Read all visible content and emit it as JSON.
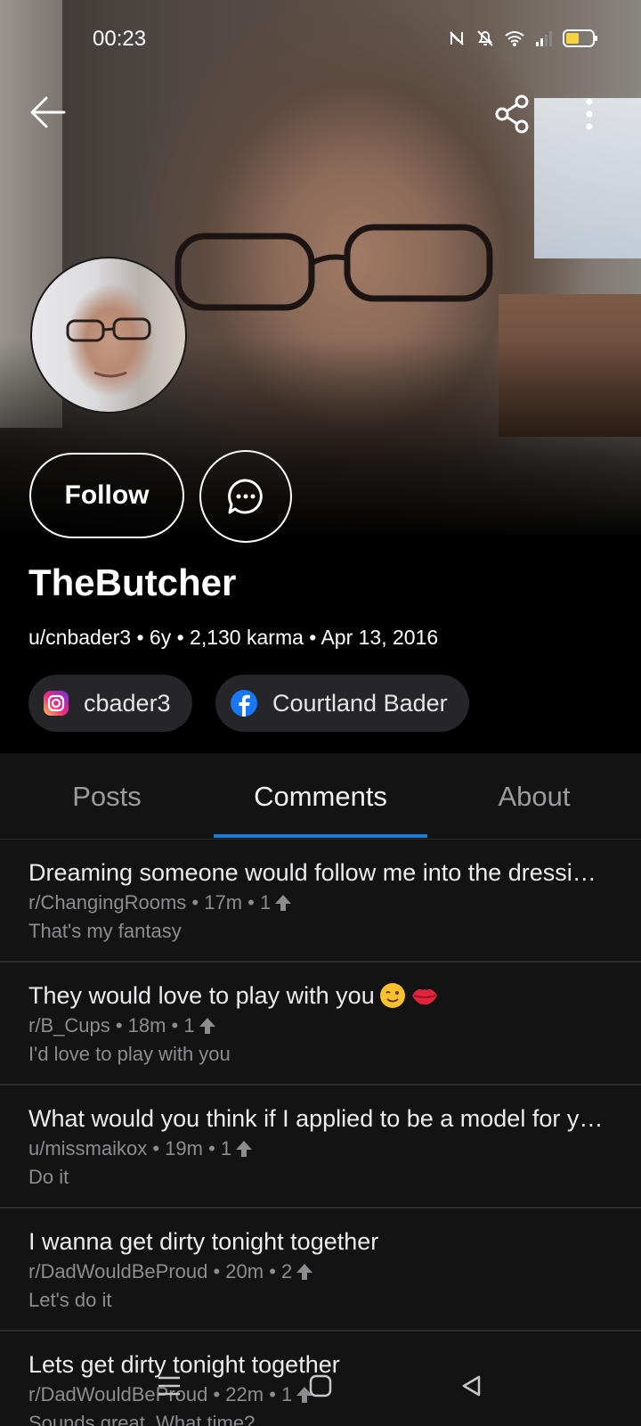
{
  "status_bar": {
    "time": "00:23"
  },
  "profile": {
    "display_name": "TheButcher",
    "meta": "u/cnbader3 • 6y • 2,130 karma • Apr 13, 2016",
    "follow_label": "Follow",
    "socials": [
      {
        "network": "instagram",
        "label": "cbader3"
      },
      {
        "network": "facebook",
        "label": "Courtland Bader"
      }
    ]
  },
  "tabs": [
    {
      "label": "Posts",
      "active": false
    },
    {
      "label": "Comments",
      "active": true
    },
    {
      "label": "About",
      "active": false
    }
  ],
  "comments": [
    {
      "title": "Dreaming someone would follow me into the dressing room",
      "meta": "r/ChangingRooms • 17m • 1",
      "body": "That's my fantasy"
    },
    {
      "title": "They would love to play with you",
      "meta": "r/B_Cups • 18m • 1",
      "body": "I'd love to play with you",
      "emojis": [
        "wink-emoji",
        "lips-emoji"
      ]
    },
    {
      "title": "What would you think if I applied to be a model for your",
      "meta": "u/missmaikox • 19m • 1",
      "body": "Do it"
    },
    {
      "title": "I wanna get dirty tonight together",
      "meta": "r/DadWouldBeProud • 20m • 2",
      "body": "Let's do it"
    },
    {
      "title": "Lets get dirty tonight together",
      "meta": "r/DadWouldBeProud • 22m • 1",
      "body": "Sounds great. What time?"
    }
  ],
  "colors": {
    "tab_indicator": "#1f7ad6",
    "background": "#131314"
  }
}
